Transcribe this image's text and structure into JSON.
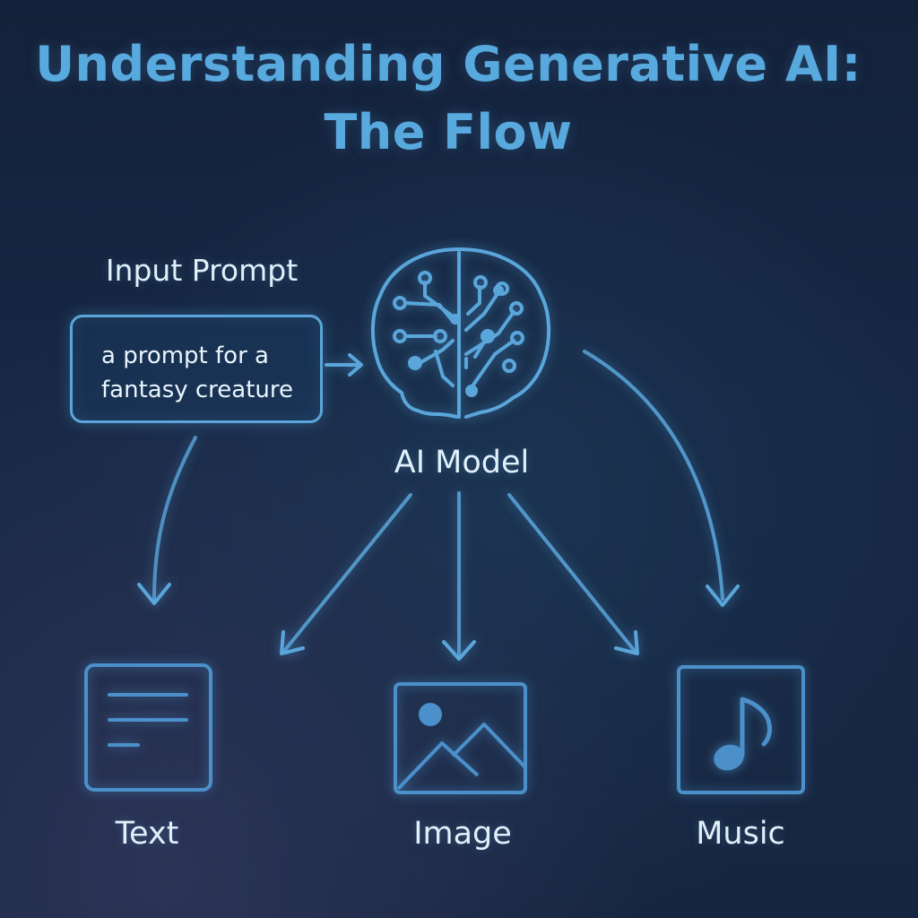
{
  "title": {
    "line1": "Understanding Generative AI:",
    "line2": "The Flow"
  },
  "input": {
    "heading": "Input Prompt",
    "prompt_line1": "a prompt for a",
    "prompt_line2": "fantasy creature"
  },
  "model": {
    "label": "AI Model",
    "icon": "brain-circuit-icon"
  },
  "outputs": [
    {
      "label": "Text",
      "icon": "text-document-icon"
    },
    {
      "label": "Image",
      "icon": "image-icon"
    },
    {
      "label": "Music",
      "icon": "music-note-icon"
    }
  ],
  "colors": {
    "background": "#162845",
    "accent": "#58a9de",
    "text": "#dff0fb"
  }
}
